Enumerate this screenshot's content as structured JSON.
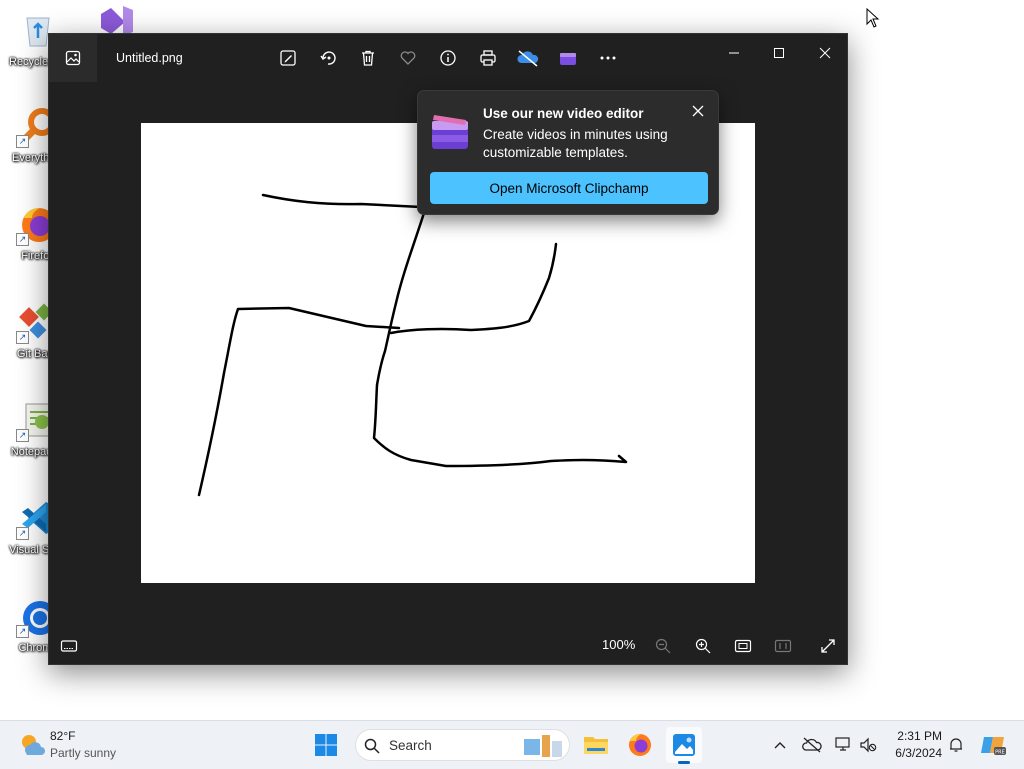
{
  "desktop": {
    "icons": [
      {
        "name": "recycle-bin",
        "label": "Recycle Bin",
        "icon": "recycle-bin-icon"
      },
      {
        "name": "everything",
        "label": "Everything",
        "icon": "magnifier-icon"
      },
      {
        "name": "firefox",
        "label": "Firefox",
        "icon": "firefox-icon"
      },
      {
        "name": "git-bash",
        "label": "Git Bash",
        "icon": "git-icon"
      },
      {
        "name": "notepad-plus-plus",
        "label": "Notepad++",
        "icon": "notepad-icon"
      },
      {
        "name": "visual-studio-code",
        "label": "Visual Studio Code",
        "icon": "vscode-icon"
      },
      {
        "name": "chrome",
        "label": "Chrome",
        "icon": "chrome-icon"
      }
    ]
  },
  "window": {
    "title": "Untitled.png",
    "toolbar": [
      {
        "name": "edit-image",
        "icon": "edit-icon"
      },
      {
        "name": "rotate",
        "icon": "rotate-icon"
      },
      {
        "name": "delete",
        "icon": "trash-icon"
      },
      {
        "name": "favorite",
        "icon": "heart-icon"
      },
      {
        "name": "file-info",
        "icon": "info-icon"
      },
      {
        "name": "print",
        "icon": "print-icon"
      },
      {
        "name": "onedrive",
        "icon": "cloud-off-icon"
      },
      {
        "name": "clipchamp",
        "icon": "clipchamp-icon"
      },
      {
        "name": "more",
        "icon": "more-icon"
      }
    ],
    "zoom": "100%"
  },
  "popup": {
    "title": "Use our new video editor",
    "body": "Create videos in minutes using customizable templates.",
    "button": "Open Microsoft Clipchamp",
    "accent": "#4cc2ff"
  },
  "taskbar": {
    "weather": {
      "temp": "82°F",
      "desc": "Partly sunny"
    },
    "search_placeholder": "Search",
    "clock": {
      "time": "2:31 PM",
      "date": "6/3/2024"
    },
    "apps": [
      "start",
      "search",
      "file-explorer",
      "firefox",
      "photos"
    ]
  },
  "colors": {
    "window_bg": "#202020",
    "taskbar_bg": "#eef1f6",
    "accent": "#0067c0"
  }
}
